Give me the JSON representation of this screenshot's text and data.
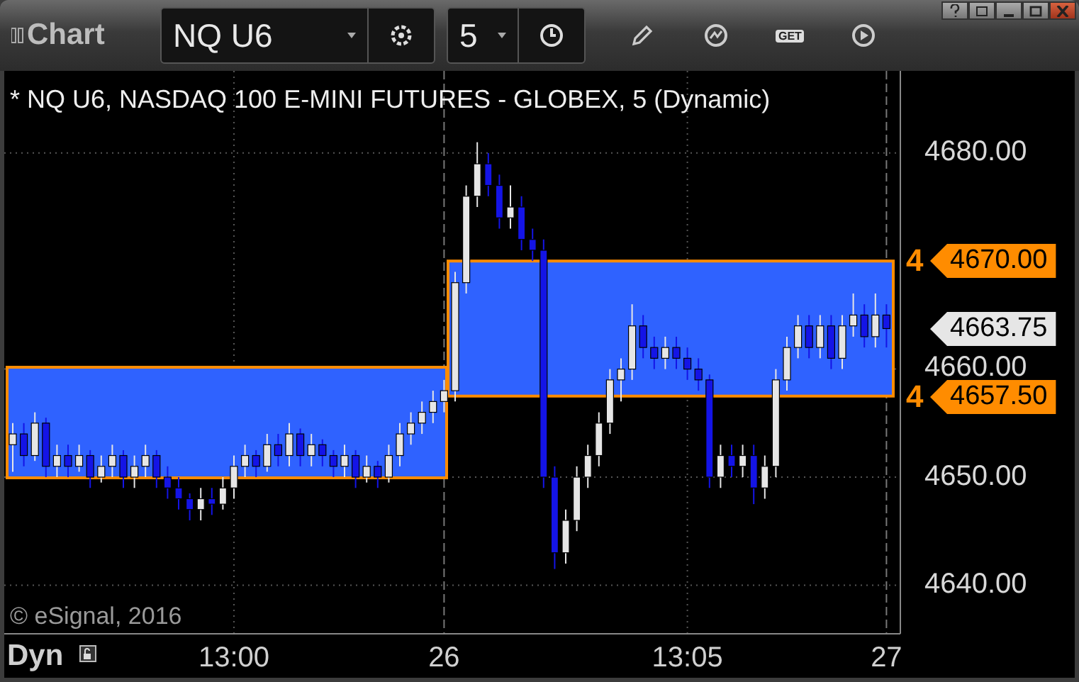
{
  "window": {
    "title": "Chart"
  },
  "toolbar": {
    "symbol": "NQ U6",
    "interval": "5",
    "get_label": "GET"
  },
  "chart": {
    "title": "* NQ U6, NASDAQ 100 E-MINI FUTURES - GLOBEX, 5 (Dynamic)",
    "level_tags": [
      {
        "count": "4",
        "price": "4670.00"
      },
      {
        "count": "4",
        "price": "4657.50"
      }
    ],
    "last_price": "4663.75",
    "copyright": "© eSignal, 2016",
    "mode": "Dyn",
    "chart_data": {
      "type": "candlestick",
      "grid": true,
      "categories": [
        null,
        null,
        null,
        null,
        null,
        null,
        null,
        null,
        null,
        null,
        null,
        null,
        null,
        null,
        null,
        null,
        null,
        null,
        null,
        null,
        "13:00",
        null,
        null,
        null,
        null,
        null,
        null,
        null,
        null,
        null,
        null,
        null,
        null,
        null,
        null,
        null,
        null,
        null,
        null,
        "26",
        null,
        null,
        null,
        null,
        null,
        null,
        null,
        null,
        null,
        null,
        null,
        null,
        null,
        null,
        null,
        null,
        null,
        null,
        null,
        null,
        null,
        "13:05",
        null,
        null,
        null,
        null,
        null,
        null,
        null,
        null,
        null,
        null,
        null,
        null,
        null,
        null,
        null,
        null,
        null,
        "27"
      ],
      "ohlc": [
        [
          4653,
          4655,
          4650.5,
          4654
        ],
        [
          4654,
          4655,
          4651,
          4652
        ],
        [
          4652,
          4656,
          4651.5,
          4655
        ],
        [
          4655,
          4655.5,
          4650,
          4651
        ],
        [
          4651,
          4653,
          4650,
          4652
        ],
        [
          4652,
          4653,
          4650,
          4651
        ],
        [
          4651,
          4653,
          4650.5,
          4652
        ],
        [
          4652,
          4652.5,
          4649,
          4650
        ],
        [
          4650,
          4652,
          4649.5,
          4651
        ],
        [
          4651,
          4653,
          4650,
          4652
        ],
        [
          4652,
          4652.5,
          4649,
          4650
        ],
        [
          4650,
          4652,
          4649,
          4651
        ],
        [
          4651,
          4653,
          4650,
          4652
        ],
        [
          4652,
          4652.5,
          4649,
          4650
        ],
        [
          4650,
          4651,
          4648,
          4649
        ],
        [
          4649,
          4650,
          4647,
          4648
        ],
        [
          4648,
          4648.5,
          4646,
          4647
        ],
        [
          4647,
          4649,
          4646,
          4648
        ],
        [
          4648,
          4649,
          4646.5,
          4647.5
        ],
        [
          4647.5,
          4650,
          4647,
          4649
        ],
        [
          4649,
          4652,
          4648,
          4651
        ],
        [
          4651,
          4653,
          4650,
          4652
        ],
        [
          4652,
          4652.5,
          4650,
          4651
        ],
        [
          4651,
          4654,
          4650.5,
          4653
        ],
        [
          4653,
          4654,
          4651,
          4652
        ],
        [
          4652,
          4655,
          4651,
          4654
        ],
        [
          4654,
          4654.5,
          4651,
          4652
        ],
        [
          4652,
          4654,
          4651,
          4653
        ],
        [
          4653,
          4653.5,
          4651,
          4652
        ],
        [
          4652,
          4652.5,
          4650,
          4651
        ],
        [
          4651,
          4653,
          4650,
          4652
        ],
        [
          4652,
          4652.5,
          4649,
          4650
        ],
        [
          4650,
          4652,
          4649.5,
          4651
        ],
        [
          4651,
          4651.5,
          4649,
          4650
        ],
        [
          4650,
          4653,
          4649.5,
          4652
        ],
        [
          4652,
          4655,
          4651,
          4654
        ],
        [
          4654,
          4656,
          4653,
          4655
        ],
        [
          4655,
          4657,
          4654,
          4656
        ],
        [
          4656,
          4658,
          4655,
          4657
        ],
        [
          4657,
          4659,
          4656,
          4658
        ],
        [
          4658,
          4669,
          4657,
          4668
        ],
        [
          4668,
          4677,
          4667,
          4676
        ],
        [
          4676,
          4681,
          4675,
          4679
        ],
        [
          4679,
          4680,
          4676,
          4677
        ],
        [
          4677,
          4678,
          4673,
          4674
        ],
        [
          4674,
          4677,
          4673,
          4675
        ],
        [
          4675,
          4676,
          4671,
          4672
        ],
        [
          4672,
          4673,
          4670,
          4671
        ],
        [
          4671,
          4672,
          4649,
          4650
        ],
        [
          4650,
          4651,
          4641.5,
          4643
        ],
        [
          4643,
          4647,
          4642,
          4646
        ],
        [
          4646,
          4651,
          4645,
          4650
        ],
        [
          4650,
          4653,
          4649,
          4652
        ],
        [
          4652,
          4656,
          4651,
          4655
        ],
        [
          4655,
          4660,
          4654,
          4659
        ],
        [
          4659,
          4661,
          4657,
          4660
        ],
        [
          4660,
          4666,
          4659,
          4664
        ],
        [
          4664,
          4665,
          4661,
          4662
        ],
        [
          4662,
          4663,
          4660,
          4661
        ],
        [
          4661,
          4663,
          4660,
          4662
        ],
        [
          4662,
          4663,
          4660,
          4661
        ],
        [
          4661,
          4662,
          4659,
          4660
        ],
        [
          4660,
          4661,
          4658,
          4659
        ],
        [
          4659,
          4659.5,
          4649,
          4650
        ],
        [
          4650,
          4653,
          4649,
          4652
        ],
        [
          4652,
          4653,
          4650,
          4651
        ],
        [
          4651,
          4653,
          4650,
          4652
        ],
        [
          4652,
          4653,
          4647.5,
          4649
        ],
        [
          4649,
          4652,
          4648,
          4651
        ],
        [
          4651,
          4660,
          4650,
          4659
        ],
        [
          4659,
          4663,
          4658,
          4662
        ],
        [
          4662,
          4665,
          4661,
          4664
        ],
        [
          4664,
          4665,
          4661,
          4662
        ],
        [
          4662,
          4665,
          4661,
          4664
        ],
        [
          4664,
          4665,
          4660,
          4661
        ],
        [
          4661,
          4665,
          4660,
          4664
        ],
        [
          4664,
          4667,
          4663,
          4665
        ],
        [
          4665,
          4666,
          4662,
          4663
        ],
        [
          4663,
          4667,
          4662,
          4665
        ],
        [
          4665,
          4666,
          4662,
          4663.75
        ]
      ],
      "ylim": [
        4635.5,
        4687.6
      ],
      "yticks": [
        {
          "value": 4680,
          "label": "4680.00"
        },
        {
          "value": 4660,
          "label": "4660.00"
        },
        {
          "value": 4650,
          "label": "4650.00"
        },
        {
          "value": 4640,
          "label": "4640.00"
        }
      ]
    }
  }
}
